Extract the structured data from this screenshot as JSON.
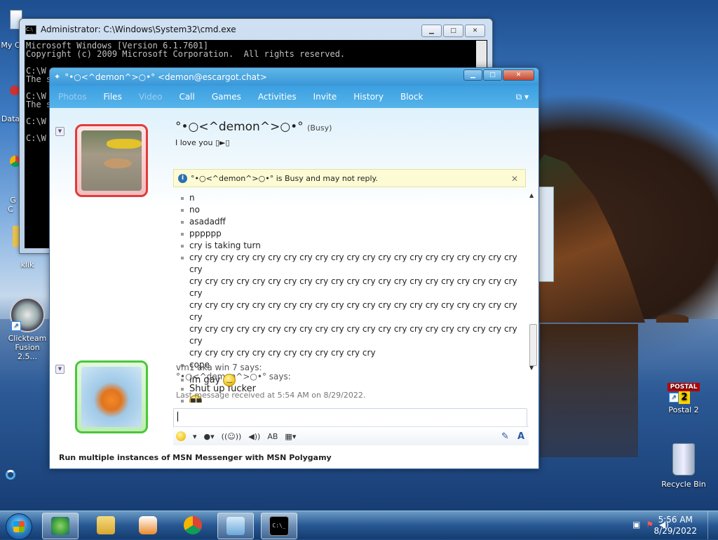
{
  "desktop": {
    "icons": [
      {
        "label": "My C",
        "id": "my-computer"
      },
      {
        "label": "Data",
        "id": "data"
      },
      {
        "label": "G\nC",
        "id": "chrome"
      },
      {
        "label": "klik",
        "id": "klik"
      },
      {
        "label": "Clickteam Fusion 2.5...",
        "id": "clickteam"
      },
      {
        "label": "Postal 2",
        "id": "postal2"
      },
      {
        "label": "Recycle Bin",
        "id": "recycle-bin"
      }
    ]
  },
  "cmd": {
    "title": "Administrator: C:\\Windows\\System32\\cmd.exe",
    "lines": [
      "Microsoft Windows [Version 6.1.7601]",
      "Copyright (c) 2009 Microsoft Corporation.  All rights reserved.",
      "",
      "C:\\W",
      "The s",
      "",
      "C:\\W",
      "The s",
      "",
      "C:\\W",
      "",
      "C:\\W"
    ]
  },
  "msn": {
    "title": "°•○<^demon^>○•° <demon@escargot.chat>",
    "menu": [
      {
        "label": "Photos",
        "disabled": true
      },
      {
        "label": "Files",
        "disabled": false
      },
      {
        "label": "Video",
        "disabled": true
      },
      {
        "label": "Call",
        "disabled": false
      },
      {
        "label": "Games",
        "disabled": false
      },
      {
        "label": "Activities",
        "disabled": false
      },
      {
        "label": "Invite",
        "disabled": false
      },
      {
        "label": "History",
        "disabled": false
      },
      {
        "label": "Block",
        "disabled": false
      }
    ],
    "contact": {
      "name": "°•○<^demon^>○•°",
      "status": "(Busy)",
      "message": "I love you ▯►▯"
    },
    "busy_notice": "°•○<^demon^>○•° is Busy and may not reply.",
    "messages_block1": [
      "n",
      "no",
      "asadadff",
      "pppppp",
      "cry is taking turn"
    ],
    "cry_lines": [
      "cry cry cry cry cry cry cry cry cry cry cry cry cry cry cry cry cry cry cry cry cry cry",
      "cry cry cry cry cry cry cry cry cry cry cry cry cry cry cry cry cry cry cry cry cry cry",
      "cry cry cry cry cry cry cry cry cry cry cry cry cry cry cry cry cry cry cry cry cry cry",
      "cry cry cry cry cry cry cry cry cry cry cry cry cry cry cry cry cry cry cry cry cry cry",
      "cry cry cry cry cry cry cry cry cry cry cry cry"
    ],
    "last_self": "cope",
    "contact_says": "°•○<^demon^>○•° says:",
    "contact_msg": "Shut up fucker",
    "me_says": "vm1 aka win 7 says:",
    "me_msg": "im gay",
    "last_received": "Last message received at 5:54 AM on 8/29/2022.",
    "footer": "Run multiple instances of MSN Messenger with MSN Polygamy"
  },
  "taskbar": {
    "time": "5:56 AM",
    "date": "8/29/2022"
  }
}
